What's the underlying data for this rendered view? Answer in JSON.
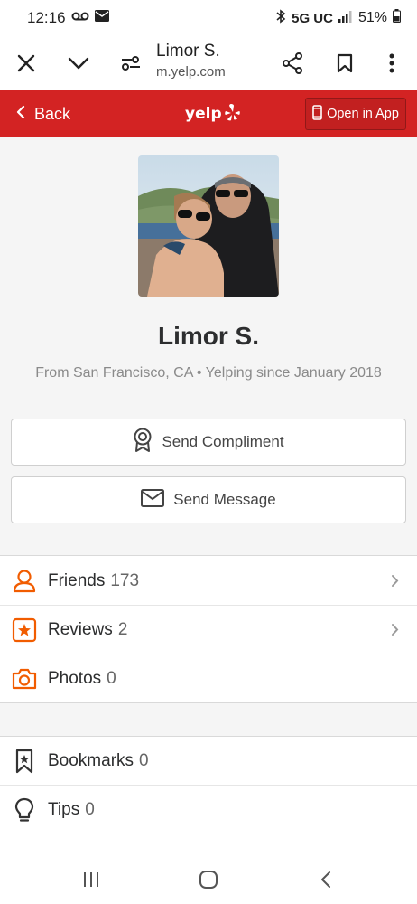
{
  "status_bar": {
    "time": "12:16",
    "network": "5G UC",
    "battery": "51%",
    "icons": [
      "voicemail-icon",
      "mail-icon",
      "bluetooth-icon",
      "signal-icon",
      "battery-icon"
    ]
  },
  "browser": {
    "title": "Limor S.",
    "url": "m.yelp.com",
    "icons": [
      "close-icon",
      "chevron-down-icon",
      "site-settings-icon",
      "share-icon",
      "bookmark-icon",
      "more-vertical-icon"
    ]
  },
  "yelp_header": {
    "back_label": "Back",
    "logo_text": "yelp",
    "open_app_label": "Open in App",
    "brand_color": "#d32323"
  },
  "profile": {
    "name": "Limor S.",
    "meta": "From San Francisco, CA • Yelping since January 2018",
    "send_compliment_label": "Send Compliment",
    "send_message_label": "Send Message"
  },
  "sections": [
    {
      "items": [
        {
          "label": "Friends",
          "count": "173",
          "icon": "friends-icon",
          "has_chevron": true
        },
        {
          "label": "Reviews",
          "count": "2",
          "icon": "reviews-star-icon",
          "has_chevron": true
        },
        {
          "label": "Photos",
          "count": "0",
          "icon": "camera-icon",
          "has_chevron": false
        }
      ]
    },
    {
      "items": [
        {
          "label": "Bookmarks",
          "count": "0",
          "icon": "bookmark-icon"
        },
        {
          "label": "Tips",
          "count": "0",
          "icon": "lightbulb-icon"
        }
      ]
    }
  ],
  "accent_color": "#f15c00",
  "nav_bar": {
    "icons": [
      "recent-apps-icon",
      "home-icon",
      "back-icon"
    ]
  }
}
